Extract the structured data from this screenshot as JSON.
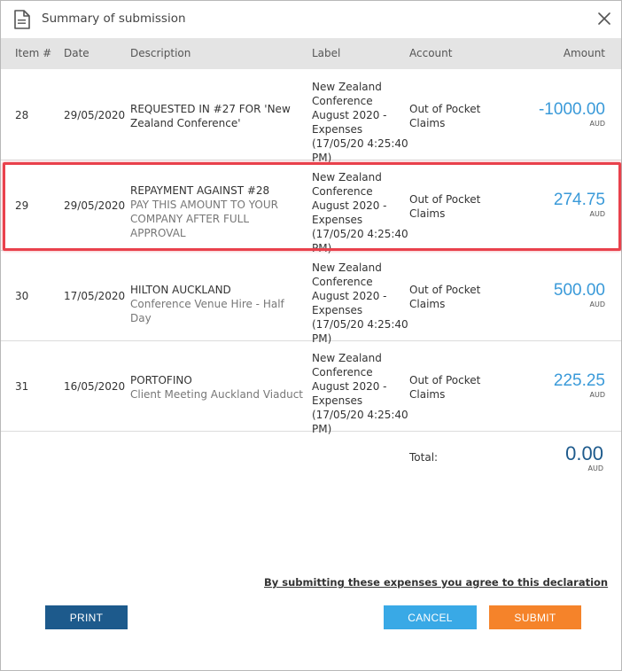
{
  "dialog": {
    "title": "Summary of submission",
    "icons": {
      "document": "document-icon",
      "close": "close-icon"
    }
  },
  "table": {
    "headers": {
      "item": "Item #",
      "date": "Date",
      "description": "Description",
      "label": "Label",
      "account": "Account",
      "amount": "Amount"
    },
    "rows": [
      {
        "item": "28",
        "date": "29/05/2020",
        "description": "REQUESTED IN #27 FOR 'New Zealand Conference'",
        "description_sub": "",
        "label": "New Zealand Conference August 2020 - Expenses (17/05/20 4:25:40 PM)",
        "account": "Out of Pocket Claims",
        "amount": "-1000.00",
        "currency": "AUD"
      },
      {
        "item": "29",
        "date": "29/05/2020",
        "description": "REPAYMENT AGAINST #28",
        "description_sub": "PAY THIS AMOUNT TO YOUR COMPANY AFTER FULL APPROVAL",
        "label": "New Zealand Conference August 2020 - Expenses (17/05/20 4:25:40 PM)",
        "account": "Out of Pocket Claims",
        "amount": "274.75",
        "currency": "AUD"
      },
      {
        "item": "30",
        "date": "17/05/2020",
        "description": "HILTON AUCKLAND",
        "description_sub": "Conference Venue Hire - Half Day",
        "label": "New Zealand Conference August 2020 - Expenses (17/05/20 4:25:40 PM)",
        "account": "Out of Pocket Claims",
        "amount": "500.00",
        "currency": "AUD"
      },
      {
        "item": "31",
        "date": "16/05/2020",
        "description": "PORTOFINO",
        "description_sub": "Client Meeting Auckland Viaduct",
        "label": "New Zealand Conference August 2020 - Expenses (17/05/20 4:25:40 PM)",
        "account": "Out of Pocket Claims",
        "amount": "225.25",
        "currency": "AUD"
      }
    ]
  },
  "total": {
    "label": "Total:",
    "amount": "0.00",
    "currency": "AUD"
  },
  "declaration": "By submitting these expenses you agree to this declaration",
  "buttons": {
    "print": "PRINT",
    "cancel": "CANCEL",
    "submit": "SUBMIT"
  },
  "colors": {
    "amount": "#3a9ad9",
    "total": "#1d5a8c",
    "print": "#1d5a8c",
    "cancel": "#39a9e6",
    "submit": "#f5832a",
    "highlight": "#e9414c"
  }
}
